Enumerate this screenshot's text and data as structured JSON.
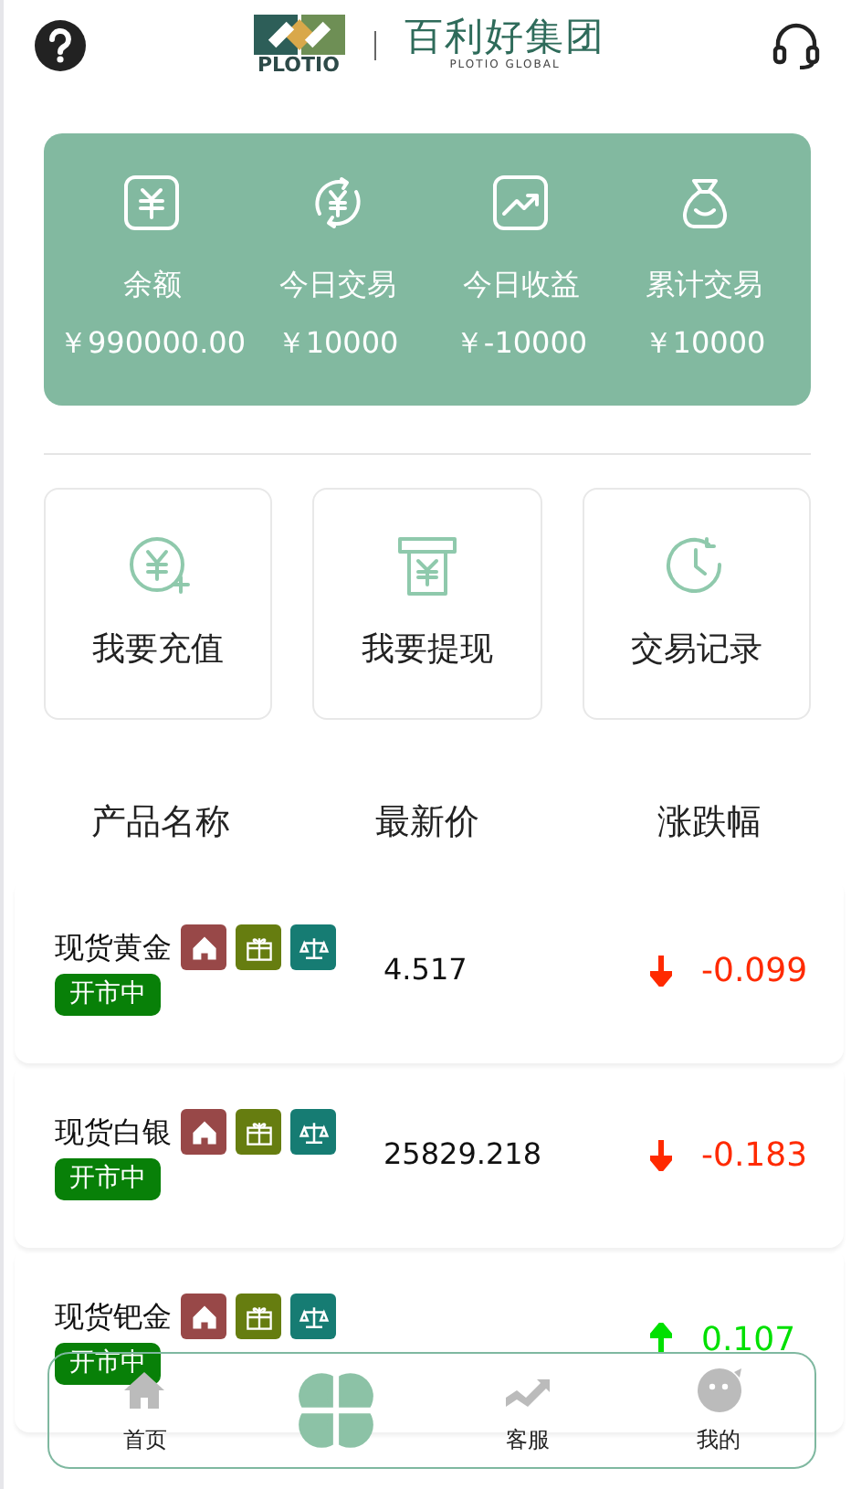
{
  "header": {
    "brand_mark": "PLOTIO",
    "brand_name": "百利好集团",
    "brand_sub": "PLOTIO GLOBAL"
  },
  "stats": [
    {
      "kind": "balance",
      "label": "余额",
      "value": "￥990000.00"
    },
    {
      "kind": "today_trade",
      "label": "今日交易",
      "value": "￥10000"
    },
    {
      "kind": "today_profit",
      "label": "今日收益",
      "value": "￥-10000"
    },
    {
      "kind": "total_trade",
      "label": "累计交易",
      "value": "￥10000"
    }
  ],
  "actions": [
    {
      "kind": "deposit",
      "label": "我要充值"
    },
    {
      "kind": "withdraw",
      "label": "我要提现"
    },
    {
      "kind": "history",
      "label": "交易记录"
    }
  ],
  "table": {
    "columns": [
      "产品名称",
      "最新价",
      "涨跌幅"
    ],
    "rows": [
      {
        "name": "现货黄金",
        "status": "开市中",
        "price": "4.517",
        "rising": false,
        "change": "-0.099"
      },
      {
        "name": "现货白银",
        "status": "开市中",
        "price": "25829.218",
        "rising": false,
        "change": "-0.183"
      },
      {
        "name": "现货钯金",
        "status": "开市中",
        "rising": true,
        "change": "0.107"
      }
    ]
  },
  "tabbar": [
    {
      "kind": "home",
      "label": "首页"
    },
    {
      "kind": "center"
    },
    {
      "kind": "service",
      "label": "客服"
    },
    {
      "kind": "mine",
      "label": "我的"
    }
  ]
}
